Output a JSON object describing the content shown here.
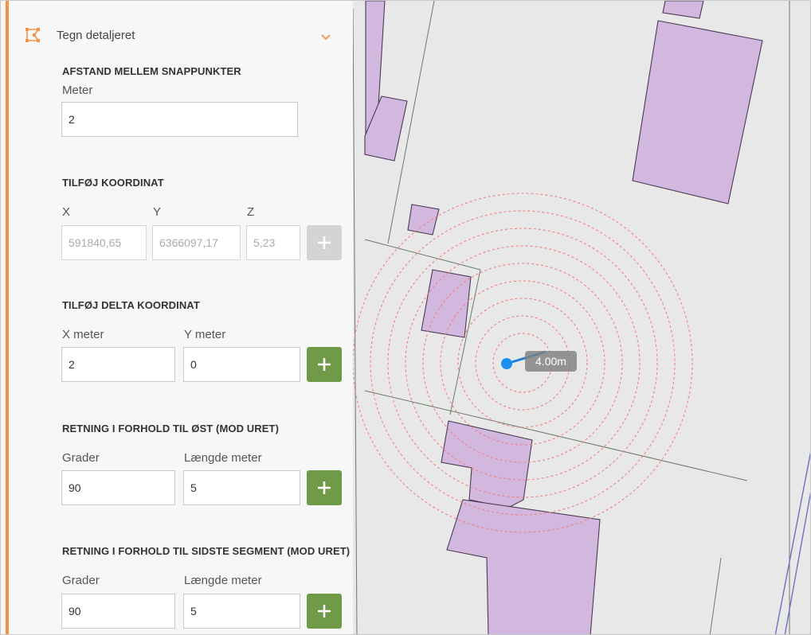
{
  "tool": {
    "icon": "draw-vertices-icon",
    "title": "Tegn detaljeret",
    "chevron_icon": "chevron-down-icon"
  },
  "snap": {
    "heading": "AFSTAND MELLEM SNAPPUNKTER",
    "meter_label": "Meter",
    "meter_value": "2"
  },
  "coord": {
    "heading": "TILFØJ KOORDINAT",
    "x_label": "X",
    "y_label": "Y",
    "z_label": "Z",
    "x_placeholder": "591840,65",
    "y_placeholder": "6366097,17",
    "z_placeholder": "5,23",
    "add_icon": "plus-icon"
  },
  "delta": {
    "heading": "TILFØJ DELTA KOORDINAT",
    "x_label": "X meter",
    "y_label": "Y meter",
    "x_value": "2",
    "y_value": "0",
    "add_icon": "plus-icon"
  },
  "east": {
    "heading": "RETNING I FORHOLD TIL ØST (MOD URET)",
    "deg_label": "Grader",
    "len_label": "Længde meter",
    "deg_value": "90",
    "len_value": "5",
    "add_icon": "plus-icon"
  },
  "segment": {
    "heading": "RETNING I FORHOLD TIL SIDSTE SEGMENT (MOD URET)",
    "deg_label": "Grader",
    "len_label": "Længde meter",
    "deg_value": "90",
    "len_value": "5",
    "add_icon": "plus-icon"
  },
  "map": {
    "distance_label": "4.00m"
  },
  "colors": {
    "accent": "#f29341",
    "button_green": "#6f9a48",
    "button_disabled": "#d4d4d4",
    "building_fill": "#d2b7de",
    "snap_ring": "#f08080",
    "draw_line": "#1a7fd6"
  }
}
